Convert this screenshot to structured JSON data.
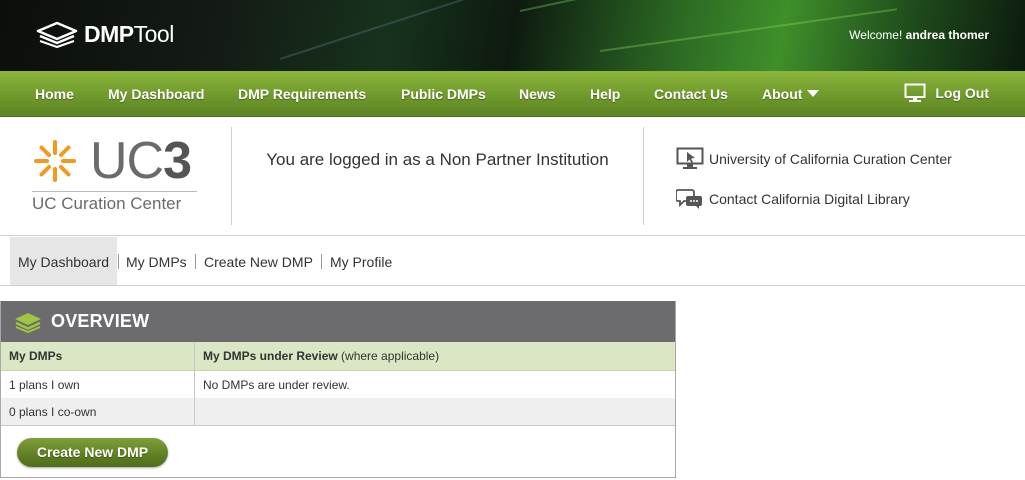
{
  "header": {
    "logo_strong": "DMP",
    "logo_light": "Tool",
    "welcome_prefix": "Welcome!",
    "user_name": "andrea thomer"
  },
  "nav": {
    "items": [
      {
        "label": "Home"
      },
      {
        "label": "My Dashboard"
      },
      {
        "label": "DMP Requirements"
      },
      {
        "label": "Public DMPs"
      },
      {
        "label": "News"
      },
      {
        "label": "Help"
      },
      {
        "label": "Contact Us"
      },
      {
        "label": "About"
      }
    ],
    "logout_label": "Log Out"
  },
  "institution": {
    "logo_text_light": "UC",
    "logo_text_bold": "3",
    "logo_subtitle": "UC Curation Center",
    "message": "You are logged in as a Non Partner Institution",
    "links": [
      {
        "label": "University of California Curation Center",
        "icon": "monitor-pointer-icon"
      },
      {
        "label": "Contact California Digital Library",
        "icon": "speech-bubbles-icon"
      }
    ]
  },
  "subnav": {
    "tabs": [
      {
        "label": "My Dashboard",
        "active": true
      },
      {
        "label": "My DMPs"
      },
      {
        "label": "Create New DMP"
      },
      {
        "label": "My Profile"
      }
    ]
  },
  "overview": {
    "title": "OVERVIEW",
    "col1_header": "My DMPs",
    "col2_header": "My DMPs under Review",
    "col2_header_note": "(where applicable)",
    "rows": [
      {
        "col1": "1 plans I own",
        "col2": "No DMPs are under review."
      },
      {
        "col1": "0 plans I co-own",
        "col2": ""
      }
    ],
    "button_label": "Create New DMP"
  },
  "colors": {
    "nav_green": "#6f9a2c",
    "panel_header_gray": "#6c6c6e",
    "table_header_green": "#dbe6c4",
    "uc3_orange": "#f39a1e",
    "button_green": "#5e7f22"
  }
}
